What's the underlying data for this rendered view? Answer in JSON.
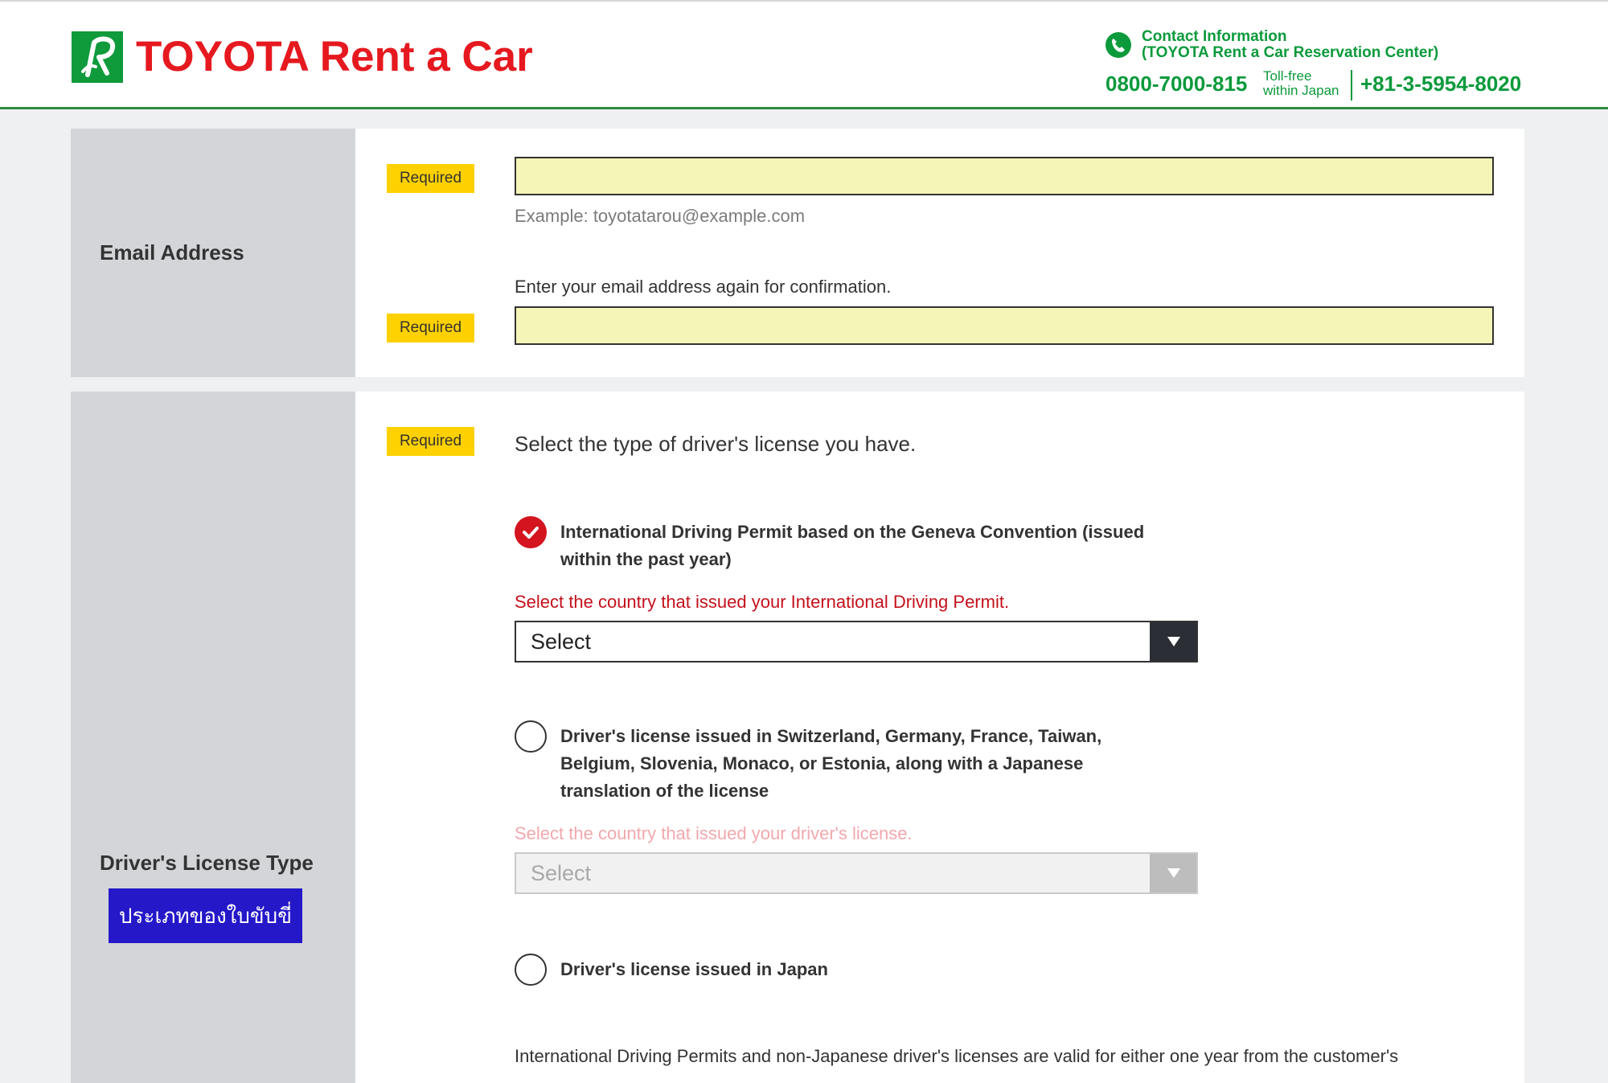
{
  "header": {
    "logo_text": "TOYOTA Rent a Car",
    "contact_title_line1": "Contact Information",
    "contact_title_line2": "(TOYOTA Rent a Car Reservation Center)",
    "phone_domestic": "0800-7000-815",
    "tollfree_line1": "Toll-free",
    "tollfree_line2": "within Japan",
    "phone_international": "+81-3-5954-8020"
  },
  "email_section": {
    "label": "Email Address",
    "required_badge": "Required",
    "example_hint": "Example: toyotatarou@example.com",
    "confirm_instruction": "Enter your email address again for confirmation.",
    "email_value": "",
    "confirm_value": ""
  },
  "license_section": {
    "label": "Driver's License Type",
    "thai_button": "ประเภทของใบขับขี่",
    "required_badge": "Required",
    "prompt": "Select the type of driver's license you have.",
    "options": [
      {
        "label_line1": "International Driving Permit based on the Geneva Convention (issued",
        "label_line2": "within the past year)",
        "checked": true,
        "sub_label": "Select the country that issued your International Driving Permit.",
        "select_value": "Select"
      },
      {
        "label_line1": "Driver's license issued in Switzerland, Germany, France, Taiwan,",
        "label_line2": "Belgium, Slovenia, Monaco, or Estonia, along with a Japanese",
        "label_line3": "translation of the license",
        "checked": false,
        "sub_label": "Select the country that issued your driver's license.",
        "select_value": "Select"
      },
      {
        "label_line1": "Driver's license issued in Japan",
        "checked": false
      }
    ],
    "footnote": "International Driving Permits and non-Japanese driver's licenses are valid for either one year from the customer's"
  },
  "colors": {
    "brand_red": "#e5191f",
    "brand_green": "#0c9a3c",
    "required_yellow": "#ffd100",
    "input_fill": "#f5f5b8",
    "error_red": "#c4111c",
    "thai_button_blue": "#2518c8"
  }
}
